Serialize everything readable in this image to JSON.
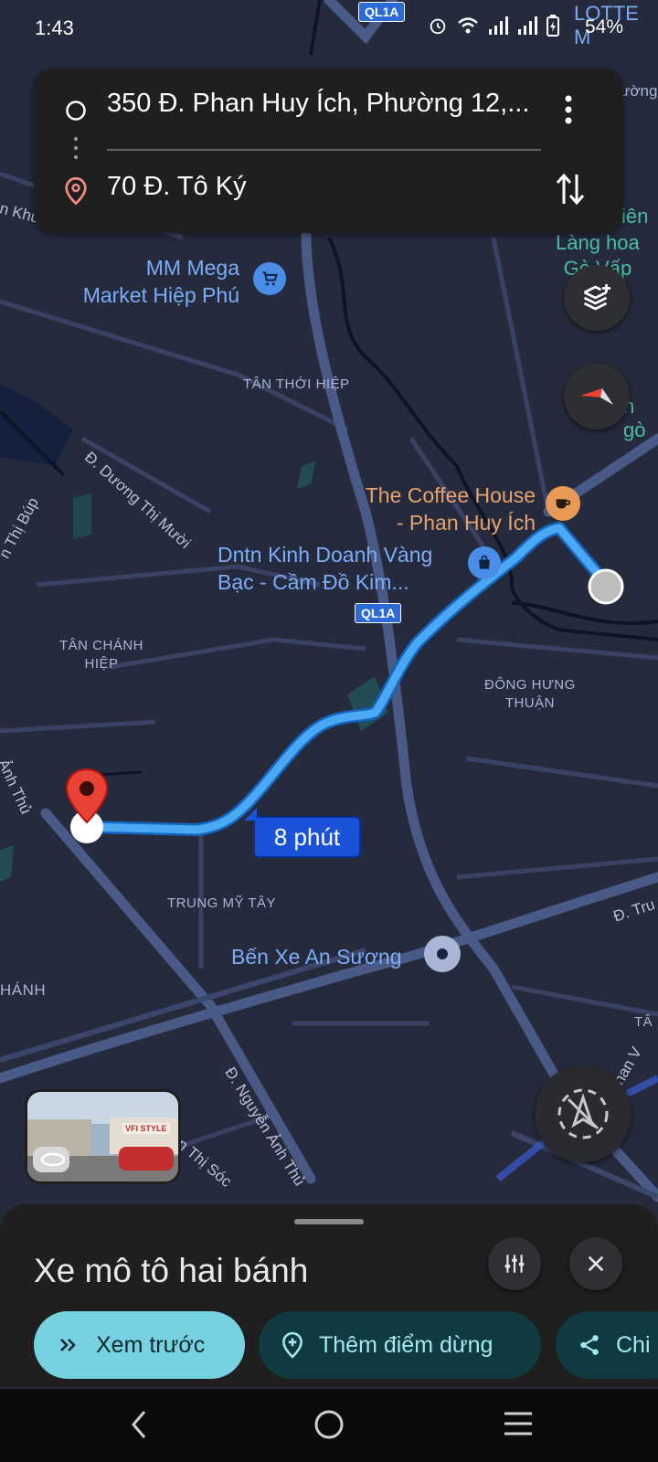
{
  "status_bar": {
    "time": "1:43",
    "battery": "54%"
  },
  "route": {
    "origin": "350 Đ. Phan Huy Ích, Phường 12,...",
    "destination": "70 Đ. Tô Ký"
  },
  "map": {
    "labels": {
      "lotte": "LOTTE M",
      "ql1a_top": "QL1A",
      "ql1a_mid": "QL1A",
      "tan_thoi_hiep": "TÂN THỚI HIỆP",
      "tan_chanh_hiep": "TÂN CHÁNH\nHIỆP",
      "dong_hung_thuan": "ĐÔNG HƯNG\nTHUẬN",
      "trung_my_tay": "TRUNG MỸ TÂY",
      "hanh": "HÁNH",
      "ta": "TÂ",
      "duong_thi_muoi": "Đ. Dương Thị Mười",
      "nguyen_anh_thu": "Đ. Nguyễn Ảnh Thủ",
      "anh_thu_left": "Ảnh Thủ",
      "thi_bup": "n Thị Búp",
      "thi_soc": "n Thị Sóc",
      "tru_right": "Đ. Tru",
      "nan_v": "nan V",
      "kh_left": "n Khu",
      "uong_right": "ường",
      "ien_right": "iên",
      "lang_hoa": "Làng hoa\nGò Vấp",
      "n_go": "n gò"
    },
    "pois": {
      "mm_mega": "MM Mega\nMarket Hiệp Phú",
      "coffee_house": "The Coffee House\n- Phan Huy Ích",
      "dntn": "Dntn Kinh Doanh Vàng\nBạc - Cầm Đồ Kim...",
      "ben_xe": "Bến Xe An Sương"
    },
    "duration": "8 phút",
    "street_view_sign": "VFI STYLE"
  },
  "sheet": {
    "mode_title": "Xe mô tô hai bánh",
    "chips": [
      {
        "label": "Xem trước"
      },
      {
        "label": "Thêm điểm dừng"
      },
      {
        "label": "Chi"
      }
    ]
  },
  "colors": {
    "route_blue": "#4aa8f5",
    "map_bg": "#252b3d",
    "preview_chip": "#78d1e0",
    "secondary_chip": "#0e3a40",
    "pin_red": "#ea4335"
  }
}
